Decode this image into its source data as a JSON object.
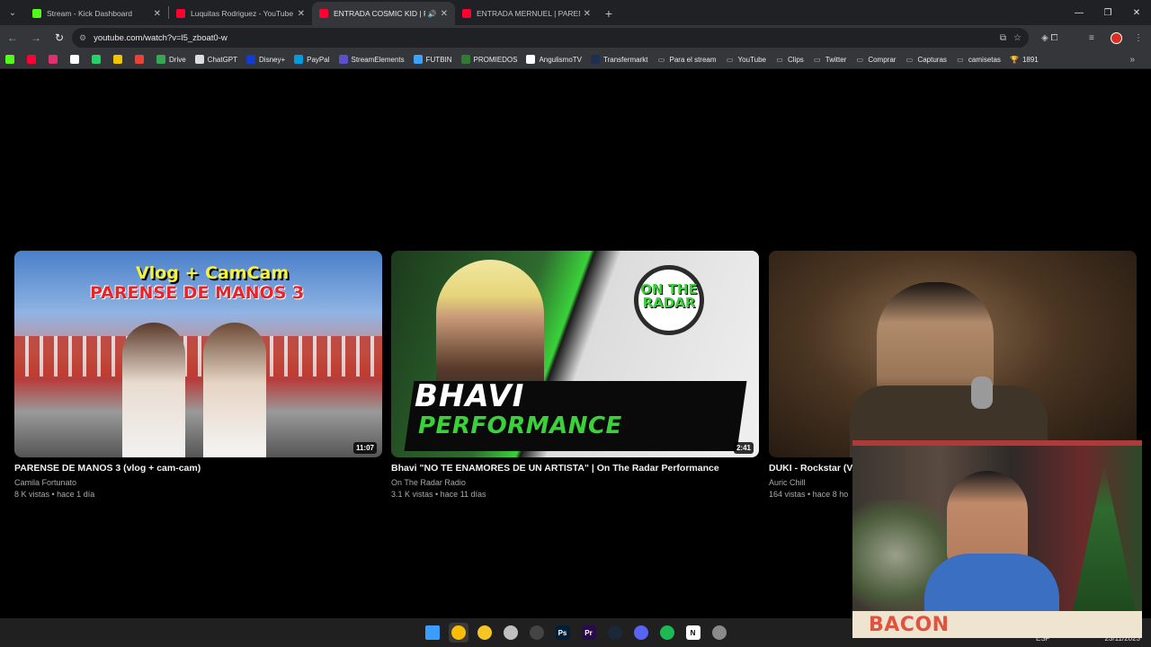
{
  "browser": {
    "tabs": [
      {
        "title": "Stream - Kick Dashboard",
        "favicon_color": "#53fc18",
        "active": false
      },
      {
        "title": "Luquitas Rodriguez - YouTube",
        "favicon_color": "#ff0033",
        "active": false
      },
      {
        "title": "ENTRADA COSMIC KID | PA",
        "favicon_color": "#ff0033",
        "active": true,
        "audio": true
      },
      {
        "title": "ENTRADA MERNUEL | PARENSE",
        "favicon_color": "#ff0033",
        "active": false
      }
    ],
    "url": "youtube.com/watch?v=l5_zboat0-w",
    "bookmarks": [
      {
        "label": "",
        "icon": "kick-icon",
        "color": "#53fc18"
      },
      {
        "label": "",
        "icon": "youtube-icon",
        "color": "#ff0033"
      },
      {
        "label": "",
        "icon": "instagram-icon",
        "color": "#e1306c"
      },
      {
        "label": "",
        "icon": "x-icon",
        "color": "#ffffff"
      },
      {
        "label": "",
        "icon": "whatsapp-icon",
        "color": "#25d366"
      },
      {
        "label": "",
        "icon": "note-icon",
        "color": "#f5c400"
      },
      {
        "label": "",
        "icon": "gmail-icon",
        "color": "#ea4335"
      },
      {
        "label": "Drive",
        "icon": "drive-icon",
        "color": "#34a853"
      },
      {
        "label": "ChatGPT",
        "icon": "chatgpt-icon",
        "color": "#dddddd"
      },
      {
        "label": "Disney+",
        "icon": "disney-icon",
        "color": "#113ccf"
      },
      {
        "label": "PayPal",
        "icon": "paypal-icon",
        "color": "#009cde"
      },
      {
        "label": "StreamElements",
        "icon": "streamelements-icon",
        "color": "#5a4fcf"
      },
      {
        "label": "FUTBIN",
        "icon": "futbin-icon",
        "color": "#3aa3ff"
      },
      {
        "label": "PROMIEDOS",
        "icon": "promiedos-icon",
        "color": "#2e7d32"
      },
      {
        "label": "AngulismoTV",
        "icon": "ball-icon",
        "color": "#ffffff"
      },
      {
        "label": "Transfermarkt",
        "icon": "transfermarkt-icon",
        "color": "#1a3151"
      },
      {
        "label": "Para el stream",
        "icon": "folder-icon",
        "color": "#bdc1c6"
      },
      {
        "label": "YouTube",
        "icon": "folder-icon",
        "color": "#bdc1c6"
      },
      {
        "label": "Clips",
        "icon": "folder-icon",
        "color": "#bdc1c6"
      },
      {
        "label": "Twitter",
        "icon": "folder-icon",
        "color": "#bdc1c6"
      },
      {
        "label": "Comprar",
        "icon": "folder-icon",
        "color": "#bdc1c6"
      },
      {
        "label": "Capturas",
        "icon": "folder-icon",
        "color": "#bdc1c6"
      },
      {
        "label": "camisetas",
        "icon": "folder-icon",
        "color": "#bdc1c6"
      },
      {
        "label": "1891",
        "icon": "trophy-icon",
        "color": "#f5c400"
      }
    ]
  },
  "videos": [
    {
      "title": "PARENSE DE MANOS 3 (vlog + cam-cam)",
      "channel": "Camila Fortunato",
      "meta": "8 K vistas • hace 1 día",
      "duration": "11:07",
      "thumb_text": [
        "Vlog + CamCam",
        "PARENSE DE MANOS 3"
      ]
    },
    {
      "title": "Bhavi \"NO TE ENAMORES DE UN ARTISTA\" | On The Radar Performance",
      "channel": "On The Radar Radio",
      "meta": "3.1 K vistas • hace 11 días",
      "duration": "2:41",
      "thumb_text": [
        "ON THE RADAR",
        "BHAVI",
        "PERFORMANCE"
      ]
    },
    {
      "title": "DUKI - Rockstar (Ve",
      "channel": "Auric Chill",
      "meta": "164 vistas • hace 8 ho",
      "duration": "",
      "thumb_text": []
    }
  ],
  "webcam": {
    "name": "BACON"
  },
  "taskbar": {
    "apps": [
      {
        "name": "windows-start-icon",
        "label": "",
        "color": "#3b9dff"
      },
      {
        "name": "chrome-icon",
        "label": "",
        "color": "#fbbc04",
        "active": true
      },
      {
        "name": "file-explorer-icon",
        "label": "",
        "color": "#f3c623"
      },
      {
        "name": "snipping-tool-icon",
        "label": "",
        "color": "#c0c0c0"
      },
      {
        "name": "obs-icon",
        "label": "",
        "color": "#444444"
      },
      {
        "name": "photoshop-icon",
        "label": "Ps",
        "color": "#001e36"
      },
      {
        "name": "premiere-icon",
        "label": "Pr",
        "color": "#2a0b4a"
      },
      {
        "name": "steam-icon",
        "label": "",
        "color": "#1b2838"
      },
      {
        "name": "discord-icon",
        "label": "",
        "color": "#5865f2"
      },
      {
        "name": "spotify-icon",
        "label": "",
        "color": "#1db954"
      },
      {
        "name": "notion-icon",
        "label": "N",
        "color": "#ffffff"
      },
      {
        "name": "settings-icon",
        "label": "",
        "color": "#8a8a8a"
      }
    ],
    "tray_time": "ESP",
    "tray_date": "23/11/2023"
  }
}
